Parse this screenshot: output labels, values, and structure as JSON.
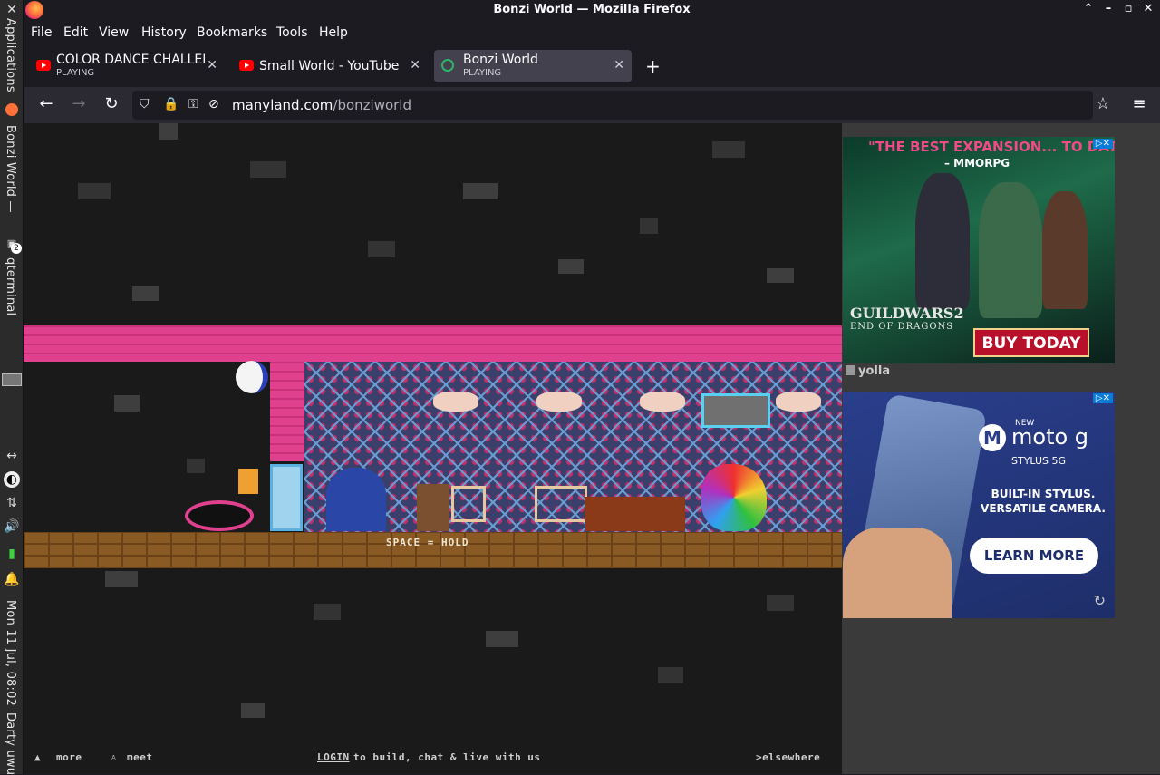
{
  "window": {
    "title": "Bonzi World — Mozilla Firefox",
    "controls": [
      "⌃",
      "–",
      "▫",
      "✕"
    ]
  },
  "taskbar": {
    "applications": "Applications",
    "task_firefox": "Bonzi World —",
    "task_terminal": "qterminal",
    "terminal_badge": "2",
    "clock": "Mon 11 Jul, 08:02",
    "user": "Darty uwu"
  },
  "menu": [
    "File",
    "Edit",
    "View",
    "History",
    "Bookmarks",
    "Tools",
    "Help"
  ],
  "tabs": [
    {
      "title": "COLOR DANCE CHALLENG",
      "subtitle": "PLAYING",
      "favicon": "youtube-icon"
    },
    {
      "title": "Small World - YouTube",
      "subtitle": "",
      "favicon": "youtube-icon"
    },
    {
      "title": "Bonzi World",
      "subtitle": "PLAYING",
      "favicon": "manyland-icon",
      "active": true
    }
  ],
  "url": {
    "host": "manyland.com",
    "path": "/bonziworld"
  },
  "game": {
    "hint": "SPACE = HOLD",
    "footer": {
      "more": "more",
      "meet": "meet",
      "login": "LOGIN",
      "login_rest": " to build, chat & live with us",
      "elsewhere": ">elsewhere"
    }
  },
  "ads": {
    "ad1": {
      "headline": "\"THE BEST EXPANSION... TO DATE\"",
      "source": "– MMORPG",
      "logo": "GUILDWARS2",
      "logo_sub": "END OF DRAGONS",
      "cta": "BUY TODAY"
    },
    "network": "yolla",
    "ad2": {
      "new": "NEW",
      "brand": "moto g",
      "model": "STYLUS 5G",
      "copy1": "BUILT-IN STYLUS.",
      "copy2": "VERSATILE CAMERA.",
      "cta": "LEARN MORE"
    }
  },
  "colors": {
    "brand_pink": "#e0418e",
    "floor": "#8a5a24",
    "firefox_dark": "#1c1b22"
  }
}
